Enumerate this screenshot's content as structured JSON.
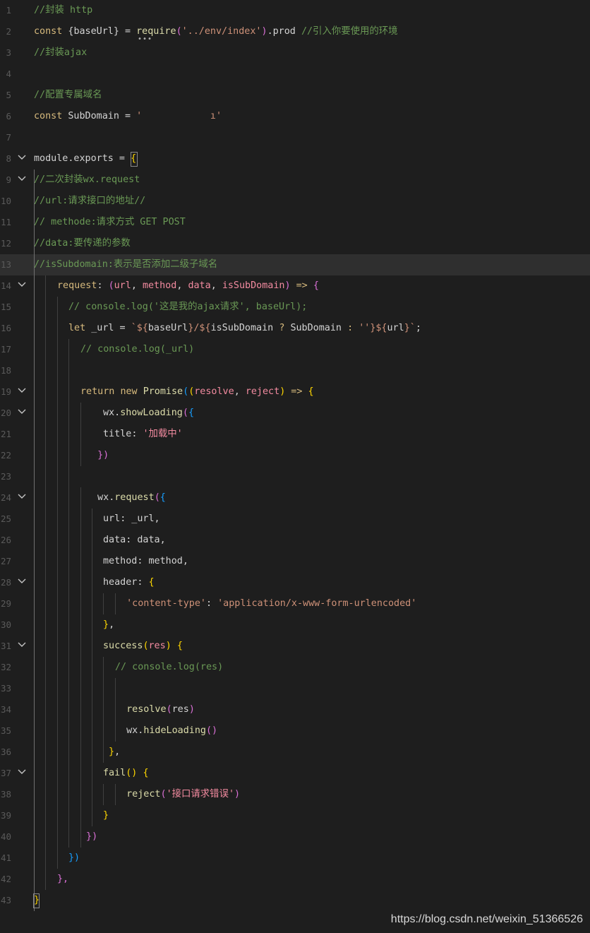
{
  "editor": {
    "lines": [
      {
        "n": "1",
        "indent": 0,
        "fold": false,
        "tokens": [
          [
            "//封装 http",
            "com"
          ]
        ]
      },
      {
        "n": "2",
        "indent": 0,
        "fold": false,
        "tokens": [
          [
            "const ",
            "kw2"
          ],
          [
            "{",
            "var"
          ],
          [
            "baseUrl",
            "var"
          ],
          [
            "} = ",
            "var"
          ],
          [
            "require",
            "fn"
          ],
          [
            "(",
            "br2"
          ],
          [
            "'../env/index'",
            "str"
          ],
          [
            ")",
            "br2"
          ],
          [
            ".prod ",
            "var"
          ],
          [
            "//引入你要使用的环境",
            "com"
          ]
        ]
      },
      {
        "n": "3",
        "indent": 0,
        "fold": false,
        "tokens": [
          [
            "//封装ajax",
            "com"
          ]
        ]
      },
      {
        "n": "4",
        "indent": 0,
        "fold": false,
        "tokens": []
      },
      {
        "n": "5",
        "indent": 0,
        "fold": false,
        "tokens": [
          [
            "//配置专属域名",
            "com"
          ]
        ]
      },
      {
        "n": "6",
        "indent": 0,
        "fold": false,
        "tokens": [
          [
            "const ",
            "kw2"
          ],
          [
            "SubDomain = ",
            "var"
          ],
          [
            "'            ı'",
            "str"
          ]
        ]
      },
      {
        "n": "7",
        "indent": 0,
        "fold": false,
        "tokens": []
      },
      {
        "n": "8",
        "indent": 0,
        "fold": true,
        "tokens": [
          [
            "module",
            "var"
          ],
          [
            ".exports = ",
            "var"
          ],
          [
            "{",
            "br1"
          ]
        ]
      },
      {
        "n": "9",
        "indent": 0,
        "fold": true,
        "tokens": [
          [
            "//二次封装wx.request",
            "com"
          ]
        ]
      },
      {
        "n": "10",
        "indent": 0,
        "fold": false,
        "tokens": [
          [
            "//url:请求接口的地址//",
            "com"
          ]
        ]
      },
      {
        "n": "11",
        "indent": 0,
        "fold": false,
        "tokens": [
          [
            "// methode:请求方式 GET POST",
            "com"
          ]
        ]
      },
      {
        "n": "12",
        "indent": 0,
        "fold": false,
        "tokens": [
          [
            "//data:要传递的参数",
            "com"
          ]
        ]
      },
      {
        "n": "13",
        "indent": 0,
        "fold": false,
        "tokens": [
          [
            "//isSubdomain:表示是否添加二级子域名",
            "com"
          ]
        ]
      },
      {
        "n": "14",
        "indent": 1,
        "fold": true,
        "tokens": [
          [
            "request",
            "kw2"
          ],
          [
            ": ",
            "var"
          ],
          [
            "(",
            "br2"
          ],
          [
            "url",
            "pk"
          ],
          [
            ", ",
            "var"
          ],
          [
            "method",
            "pk"
          ],
          [
            ", ",
            "var"
          ],
          [
            "data",
            "pk"
          ],
          [
            ", ",
            "var"
          ],
          [
            "isSubDomain",
            "pk"
          ],
          [
            ")",
            "br2"
          ],
          [
            " => ",
            "kw2"
          ],
          [
            "{",
            "br2"
          ]
        ]
      },
      {
        "n": "15",
        "indent": 2,
        "fold": false,
        "tokens": [
          [
            "// console.log('这是我的ajax请求', baseUrl);",
            "com"
          ]
        ]
      },
      {
        "n": "16",
        "indent": 2,
        "fold": false,
        "tokens": [
          [
            "let ",
            "kw2"
          ],
          [
            "_url = ",
            "var"
          ],
          [
            "`${",
            "str"
          ],
          [
            "baseUrl",
            "var"
          ],
          [
            "}/${",
            "str"
          ],
          [
            "isSubDomain ",
            "var"
          ],
          [
            "? ",
            "kw2"
          ],
          [
            "SubDomain ",
            "var"
          ],
          [
            ": ",
            "kw2"
          ],
          [
            "''",
            "str"
          ],
          [
            "}${",
            "str"
          ],
          [
            "url",
            "var"
          ],
          [
            "}`",
            "str"
          ],
          [
            ";",
            "var"
          ]
        ]
      },
      {
        "n": "17",
        "indent": 3,
        "fold": false,
        "tokens": [
          [
            "// console.log(_url)",
            "com"
          ]
        ]
      },
      {
        "n": "18",
        "indent": 3,
        "fold": false,
        "tokens": []
      },
      {
        "n": "19",
        "indent": 3,
        "fold": true,
        "tokens": [
          [
            "return ",
            "kw2"
          ],
          [
            "new ",
            "kw2"
          ],
          [
            "Promise",
            "fn"
          ],
          [
            "(",
            "br3"
          ],
          [
            "(",
            "br1"
          ],
          [
            "resolve",
            "pk"
          ],
          [
            ", ",
            "var"
          ],
          [
            "reject",
            "pk"
          ],
          [
            ")",
            "br1"
          ],
          [
            " => ",
            "kw2"
          ],
          [
            "{",
            "br1"
          ]
        ]
      },
      {
        "n": "20",
        "indent": 4,
        "fold": true,
        "tokens": [
          [
            "wx",
            "var"
          ],
          [
            ".",
            "var"
          ],
          [
            "showLoading",
            "fn"
          ],
          [
            "(",
            "br2"
          ],
          [
            "{",
            "br3"
          ]
        ]
      },
      {
        "n": "21",
        "indent": 4,
        "fold": false,
        "tokens": [
          [
            "title",
            "var"
          ],
          [
            ": ",
            "var"
          ],
          [
            "'加载中'",
            "pk"
          ]
        ]
      },
      {
        "n": "22",
        "indent": 3,
        "fold": false,
        "tokens": [
          [
            " ",
            "var"
          ],
          [
            "})",
            "br2"
          ]
        ]
      },
      {
        "n": "23",
        "indent": 3,
        "fold": false,
        "tokens": []
      },
      {
        "n": "24",
        "indent": 3,
        "fold": true,
        "tokens": [
          [
            " wx",
            "var"
          ],
          [
            ".",
            "var"
          ],
          [
            "request",
            "fn"
          ],
          [
            "(",
            "br2"
          ],
          [
            "{",
            "br3"
          ]
        ]
      },
      {
        "n": "25",
        "indent": 4,
        "fold": false,
        "tokens": [
          [
            "url",
            "var"
          ],
          [
            ": _url,",
            "var"
          ]
        ]
      },
      {
        "n": "26",
        "indent": 4,
        "fold": false,
        "tokens": [
          [
            "data",
            "var"
          ],
          [
            ": data,",
            "var"
          ]
        ]
      },
      {
        "n": "27",
        "indent": 4,
        "fold": false,
        "tokens": [
          [
            "method",
            "var"
          ],
          [
            ": method,",
            "var"
          ]
        ]
      },
      {
        "n": "28",
        "indent": 4,
        "fold": true,
        "tokens": [
          [
            "header",
            "var"
          ],
          [
            ": ",
            "var"
          ],
          [
            "{",
            "br1"
          ]
        ]
      },
      {
        "n": "29",
        "indent": 5,
        "fold": false,
        "tokens": [
          [
            "  'content-type'",
            "str"
          ],
          [
            ": ",
            "var"
          ],
          [
            "'application/x-www-form-urlencoded'",
            "str"
          ]
        ]
      },
      {
        "n": "30",
        "indent": 4,
        "fold": false,
        "tokens": [
          [
            "}",
            "br1"
          ],
          [
            ",",
            "var"
          ]
        ]
      },
      {
        "n": "31",
        "indent": 4,
        "fold": true,
        "tokens": [
          [
            "success",
            "fn"
          ],
          [
            "(",
            "br1"
          ],
          [
            "res",
            "pk"
          ],
          [
            ")",
            "br1"
          ],
          [
            " ",
            "var"
          ],
          [
            "{",
            "br1"
          ]
        ]
      },
      {
        "n": "32",
        "indent": 5,
        "fold": false,
        "tokens": [
          [
            "// console.log(res)",
            "com"
          ]
        ]
      },
      {
        "n": "33",
        "indent": 5,
        "fold": false,
        "tokens": []
      },
      {
        "n": "34",
        "indent": 5,
        "fold": false,
        "tokens": [
          [
            "  resolve",
            "fn"
          ],
          [
            "(",
            "br2"
          ],
          [
            "res",
            "var"
          ],
          [
            ")",
            "br2"
          ]
        ]
      },
      {
        "n": "35",
        "indent": 5,
        "fold": false,
        "tokens": [
          [
            "  wx",
            "var"
          ],
          [
            ".",
            "var"
          ],
          [
            "hideLoading",
            "fn"
          ],
          [
            "()",
            "br2"
          ]
        ]
      },
      {
        "n": "36",
        "indent": 4,
        "fold": false,
        "tokens": [
          [
            " }",
            "br1"
          ],
          [
            ",",
            "var"
          ]
        ]
      },
      {
        "n": "37",
        "indent": 4,
        "fold": true,
        "tokens": [
          [
            "fail",
            "fn"
          ],
          [
            "()",
            "br1"
          ],
          [
            " ",
            "var"
          ],
          [
            "{",
            "br1"
          ]
        ]
      },
      {
        "n": "38",
        "indent": 5,
        "fold": false,
        "tokens": [
          [
            "  reject",
            "fn"
          ],
          [
            "(",
            "br2"
          ],
          [
            "'接口请求错误'",
            "pk"
          ],
          [
            ")",
            "br2"
          ]
        ]
      },
      {
        "n": "39",
        "indent": 4,
        "fold": false,
        "tokens": [
          [
            "}",
            "br1"
          ]
        ]
      },
      {
        "n": "40",
        "indent": 3,
        "fold": false,
        "tokens": [
          [
            " })",
            "br2"
          ]
        ]
      },
      {
        "n": "41",
        "indent": 2,
        "fold": false,
        "tokens": [
          [
            "})",
            "br3"
          ]
        ]
      },
      {
        "n": "42",
        "indent": 1,
        "fold": false,
        "tokens": [
          [
            "},",
            "br2"
          ]
        ]
      },
      {
        "n": "43",
        "indent": 0,
        "fold": false,
        "tokens": [
          [
            "}",
            "br1"
          ]
        ]
      }
    ]
  },
  "watermark": {
    "text": "https://blog.csdn.net/weixin_51366526"
  },
  "colors": {
    "background": "#1e1e1e",
    "line_highlight": "#2f2f2f",
    "comment": "#6a9955",
    "string": "#ce9178",
    "keyword": "#d7ba7d",
    "function": "#dcdcaa",
    "parameter": "#f38ba0"
  },
  "icons": {
    "fold": "chevron-down-icon",
    "hover_dots": "ellipsis-icon"
  }
}
